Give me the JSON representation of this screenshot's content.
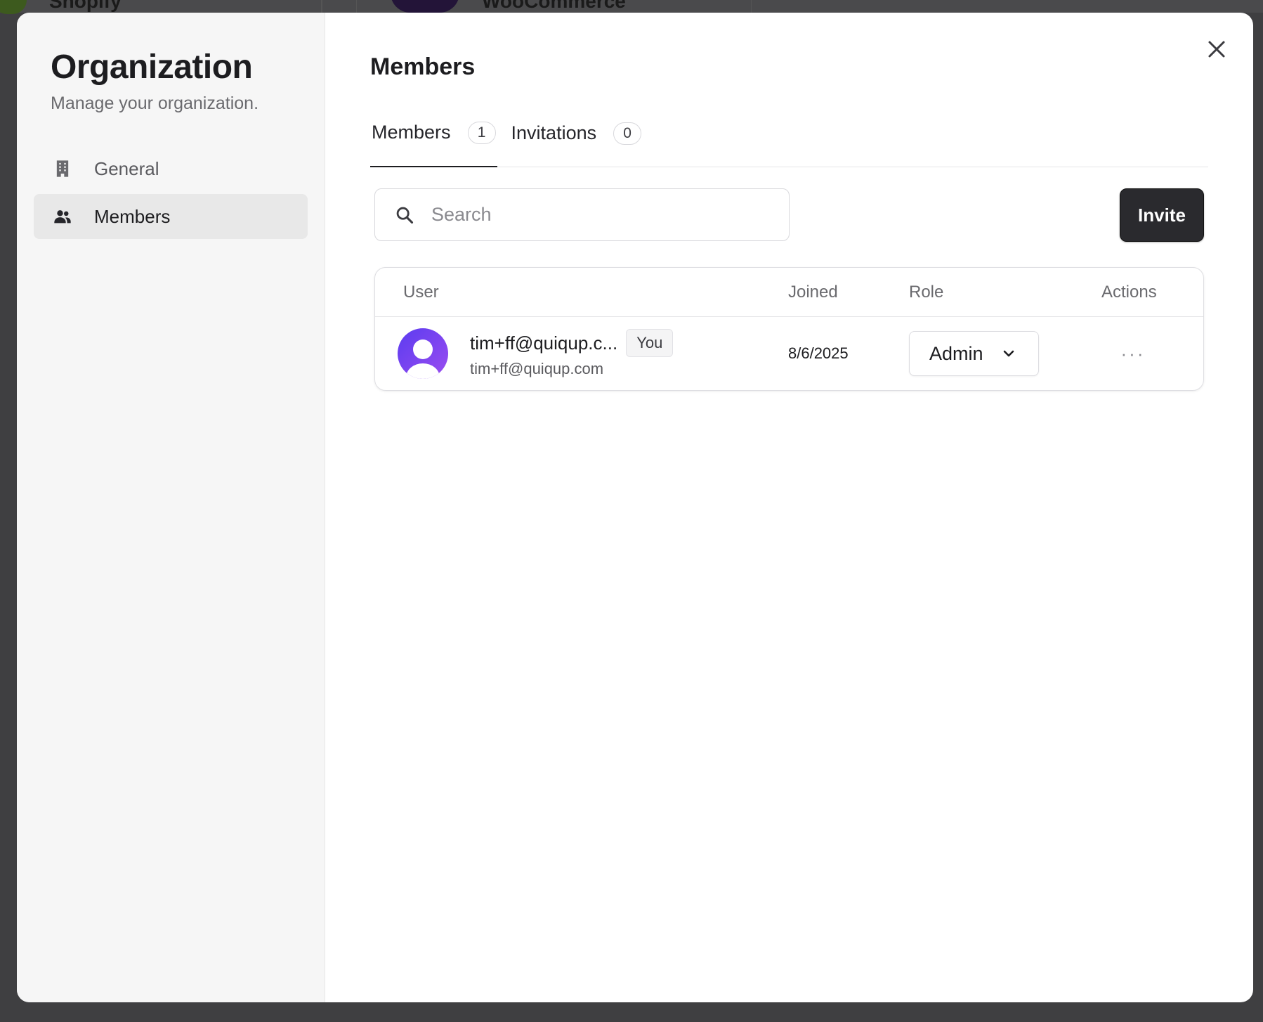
{
  "background": {
    "app_texts": [
      "Shopify",
      "WooCommerce"
    ]
  },
  "sidebar": {
    "title": "Organization",
    "subtitle": "Manage your organization.",
    "items": [
      {
        "label": "General",
        "icon": "building-icon",
        "active": false
      },
      {
        "label": "Members",
        "icon": "users-icon",
        "active": true
      }
    ]
  },
  "main": {
    "title": "Members",
    "tabs": [
      {
        "label": "Members",
        "count": "1",
        "active": true
      },
      {
        "label": "Invitations",
        "count": "0",
        "active": false
      }
    ],
    "search": {
      "placeholder": "Search",
      "value": ""
    },
    "invite_label": "Invite",
    "table": {
      "headers": {
        "user": "User",
        "joined": "Joined",
        "role": "Role",
        "actions": "Actions"
      },
      "rows": [
        {
          "name": "tim+ff@quiqup.c...",
          "badge": "You",
          "email": "tim+ff@quiqup.com",
          "joined": "8/6/2025",
          "role": "Admin",
          "actions": "···"
        }
      ]
    }
  },
  "colors": {
    "accent": "#2a2a2e",
    "avatar_gradient_start": "#5b3cf0",
    "avatar_gradient_end": "#9b4df0",
    "overlay": "#3f3f41"
  }
}
